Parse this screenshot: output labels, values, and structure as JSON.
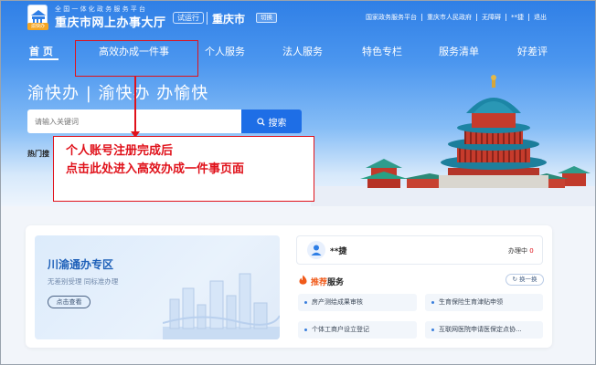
{
  "header": {
    "site_subtitle": "全国一体化政务服务平台",
    "site_name": "重庆市网上办事大厅",
    "logo_badge": "渝快办",
    "trial_tag": "试运行",
    "city": "重庆市",
    "switch_label": "切换",
    "links": [
      "国家政务服务平台",
      "重庆市人民政府",
      "无障碍",
      "**捷",
      "退出"
    ]
  },
  "nav": {
    "items": [
      "首  页",
      "高效办成一件事",
      "个人服务",
      "法人服务",
      "特色专栏",
      "服务清单",
      "好差评"
    ]
  },
  "hero": {
    "slogan": "渝快办 | 渝快办 办愉快",
    "search_placeholder": "请输入关键词",
    "search_button": "搜索",
    "hot_label": "热门搜"
  },
  "annotation": {
    "line1": "个人账号注册完成后",
    "line2": "点击此处进入高效办成一件事页面",
    "color": "#e0121b"
  },
  "zone": {
    "title": "川渝通办专区",
    "subtitle": "无差别受理  同标准办理",
    "button": "点击查看"
  },
  "user": {
    "name": "**捷",
    "processing_label": "办理中",
    "processing_count": "0"
  },
  "recommend": {
    "title_highlight": "推荐",
    "title_rest": "服务",
    "swap": "换一换",
    "services": [
      "房产测绘成果审核",
      "生育保险生育津贴申领",
      "个体工商户设立登记",
      "互联网医院申请医保定点协..."
    ]
  },
  "colors": {
    "primary": "#1e6ee6",
    "hero_top": "#2f7fe6",
    "accent_red": "#e0121b",
    "accent_orange": "#f05a1a"
  }
}
